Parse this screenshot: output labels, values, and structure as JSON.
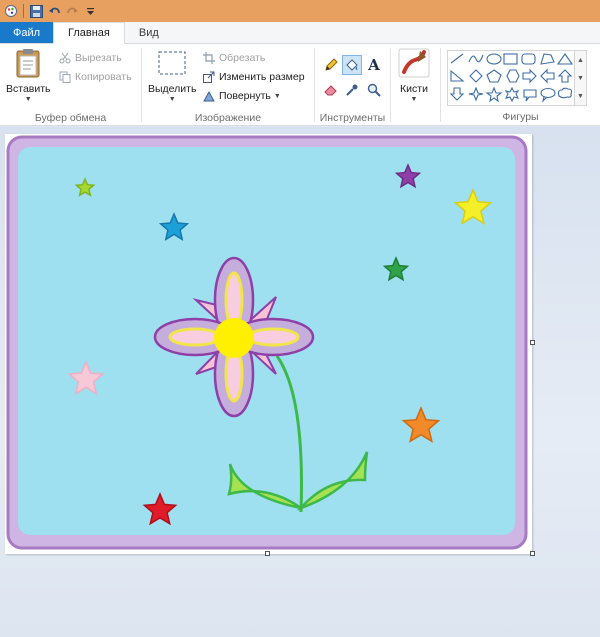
{
  "quick_access": {
    "icons": [
      "paint-app-icon",
      "save-icon",
      "undo-icon",
      "redo-icon",
      "customize-dropdown-icon"
    ]
  },
  "tabs": {
    "file": "Файл",
    "home": "Главная",
    "view": "Вид"
  },
  "ribbon": {
    "clipboard": {
      "paste": "Вставить",
      "cut": "Вырезать",
      "copy": "Копировать",
      "label": "Буфер обмена"
    },
    "image": {
      "select": "Выделить",
      "crop": "Обрезать",
      "resize": "Изменить размер",
      "rotate": "Повернуть",
      "label": "Изображение"
    },
    "tools": {
      "label": "Инструменты",
      "items": [
        "pencil-icon",
        "fill-icon",
        "text-icon",
        "eraser-icon",
        "color-picker-icon",
        "magnifier-icon"
      ],
      "selected": "fill-icon"
    },
    "brushes": {
      "label": "Кисти"
    },
    "shapes": {
      "label": "Фигуры"
    }
  },
  "colors": {
    "accent": "#1979ca",
    "titlebar": "#e8a060",
    "frame": "#a77ac2",
    "frame_fill": "#cfb5e4",
    "sky": "#9edff0",
    "petal": "#c6aedc",
    "petal_inner": "#f9cde0",
    "flower_center": "#ffef00",
    "stem": "#3db84a",
    "leaf": "#a6e152"
  },
  "canvas": {
    "stars": [
      {
        "name": "star-lime",
        "color": "#a7d830"
      },
      {
        "name": "star-blue",
        "color": "#1d9fd8"
      },
      {
        "name": "star-purple",
        "color": "#8e3fa8"
      },
      {
        "name": "star-yellow",
        "color": "#f5ef2a"
      },
      {
        "name": "star-green",
        "color": "#2fa24a"
      },
      {
        "name": "star-pink",
        "color": "#f7c8d8"
      },
      {
        "name": "star-orange",
        "color": "#f08a2a"
      },
      {
        "name": "star-red",
        "color": "#e11c2a"
      }
    ]
  }
}
